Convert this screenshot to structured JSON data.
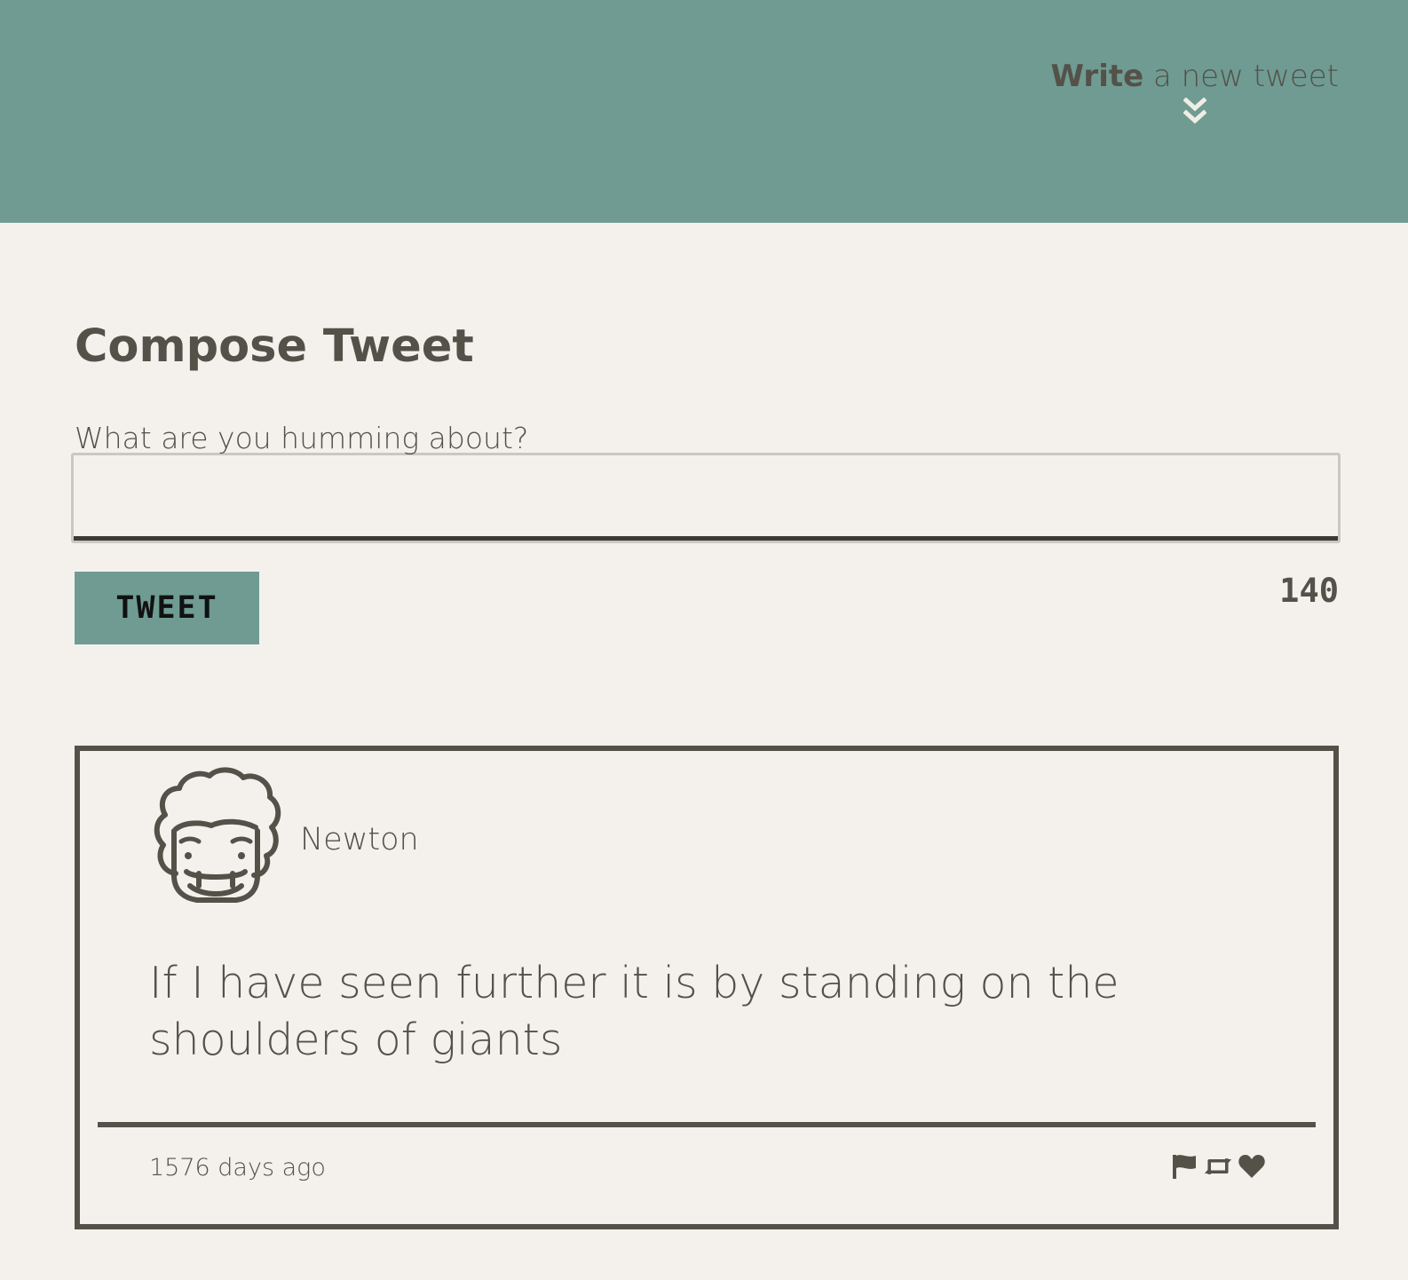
{
  "header": {
    "write_bold": "Write",
    "write_rest": " a new tweet",
    "toggle_icon": "double-chevron-down-icon",
    "background_color": "#6f9b92"
  },
  "compose": {
    "title": "Compose Tweet",
    "label": "What are you humming about?",
    "input_value": "",
    "button_label": "TWEET",
    "char_count": "140"
  },
  "tweets": [
    {
      "avatar_icon": "curly-hair-face-avatar-icon",
      "username": "Newton",
      "text": "If I have seen further it is by standing on the shoulders of giants",
      "timestamp": "1576 days ago",
      "actions": [
        "flag-icon",
        "retweet-icon",
        "heart-icon"
      ]
    }
  ],
  "colors": {
    "page_background": "#f4f1ec",
    "text": "#545149",
    "accent": "#6f9b92"
  }
}
